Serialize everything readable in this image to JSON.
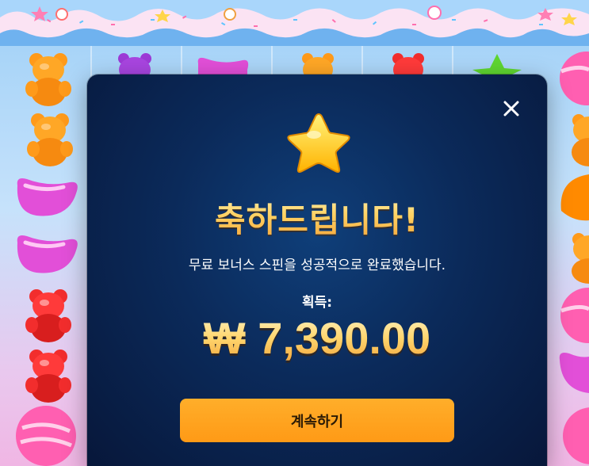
{
  "modal": {
    "title": "축하드립니다!",
    "message": "무료 보너스 스핀을 성공적으로 완료했습니다.",
    "win_label": "획득:",
    "win_amount": "₩ 7,390.00",
    "continue_label": "계속하기"
  },
  "reels": {
    "symbols": [
      "orange-gummy-bear",
      "orange-gummy-bear",
      "pink-jellybean",
      "pink-jellybean",
      "red-gummy-bear",
      "red-gummy-bear",
      "pink-lollipop",
      "purple-gummy-bear",
      "pink-jellybean",
      "orange-gummy-bear",
      "red-gummy-bear",
      "green-star-candy",
      "orange-gummy-bear",
      "orange-jelly",
      "pink-lollipop"
    ]
  },
  "colors": {
    "modal_bg": "#0b2a5a",
    "button": "#ff9f1a",
    "title_gold": "#ffd263"
  }
}
